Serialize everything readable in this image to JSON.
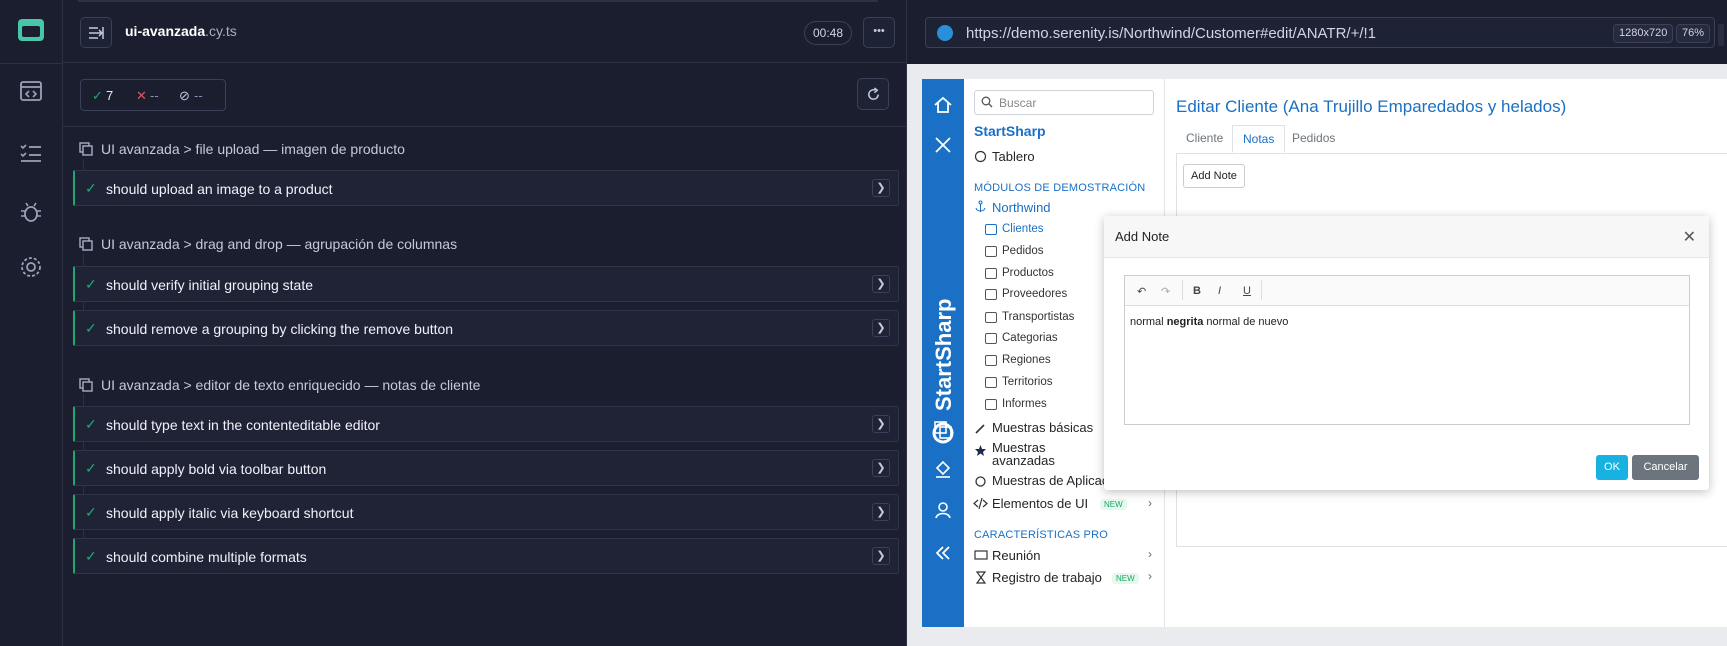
{
  "runner": {
    "file_name": "ui-avanzada",
    "file_ext": ".cy.ts",
    "timer": "00:48",
    "more_label": "•••",
    "stats": {
      "passed": "7",
      "failed": "--",
      "pending": "--"
    },
    "suites": [
      {
        "title": "UI avanzada > file upload — imagen de producto",
        "tests": [
          "should upload an image to a product"
        ]
      },
      {
        "title": "UI avanzada > drag and drop — agrupación de columnas",
        "tests": [
          "should verify initial grouping state",
          "should remove a grouping by clicking the remove button"
        ]
      },
      {
        "title": "UI avanzada > editor de texto enriquecido — notas de cliente",
        "tests": [
          "should type text in the contenteditable editor",
          "should apply bold via toolbar button",
          "should apply italic via keyboard shortcut",
          "should combine multiple formats"
        ]
      }
    ]
  },
  "browser": {
    "url": "https://demo.serenity.is/Northwind/Customer#edit/ANATR/+/!1",
    "viewport": "1280x720",
    "zoom": "76%"
  },
  "app": {
    "brand": "StartSharp",
    "search_placeholder": "Buscar",
    "nav_title": "StartSharp",
    "dashboard": "Tablero",
    "section_demo": "MÓDULOS DE DEMOSTRACIÓN",
    "northwind": "Northwind",
    "sub_items": [
      "Clientes",
      "Pedidos",
      "Productos",
      "Proveedores",
      "Transportistas",
      "Categorias",
      "Regiones",
      "Territorios",
      "Informes"
    ],
    "samples_basic": "Muestras básicas",
    "samples_adv_1": "Muestras",
    "samples_adv_2": "avanzadas",
    "samples_app": "Muestras de Aplicación",
    "ui_elements": "Elementos de UI",
    "new_badge": "NEW",
    "section_pro": "CARACTERÍSTICAS PRO",
    "meeting": "Reunión",
    "worklog": "Registro de trabajo",
    "page_title": "Editar Cliente (Ana Trujillo Emparedados y helados)",
    "tabs": [
      "Cliente",
      "Notas",
      "Pedidos"
    ],
    "add_note_button": "Add Note",
    "modal": {
      "title": "Add Note",
      "text_normal": "normal ",
      "text_bold": "negrita",
      "text_after": " normal de nuevo",
      "ok": "OK",
      "cancel": "Cancelar"
    }
  }
}
